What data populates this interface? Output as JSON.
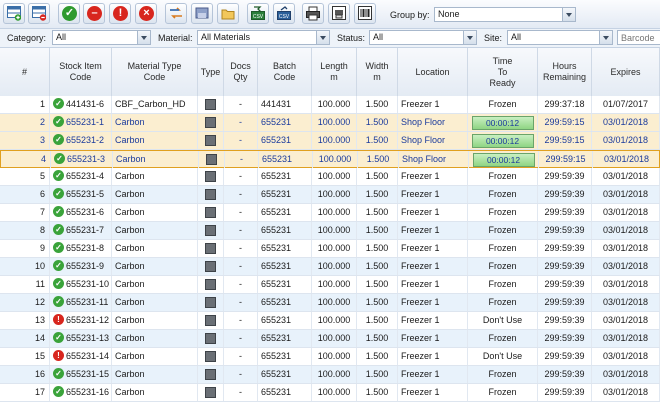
{
  "toolbar": {
    "group_by_label": "Group by:",
    "group_by_value": "None",
    "buttons": [
      {
        "name": "add-grid-icon"
      },
      {
        "name": "remove-grid-icon"
      },
      {
        "name": "approve-icon"
      },
      {
        "name": "stop-icon"
      },
      {
        "name": "alert-icon"
      },
      {
        "name": "cancel-icon"
      },
      {
        "name": "transfer-icon"
      },
      {
        "name": "location-icon"
      },
      {
        "name": "folder-icon"
      },
      {
        "name": "csv-import-icon",
        "label": "CSV"
      },
      {
        "name": "csv-export-icon",
        "label": "CSV"
      },
      {
        "name": "print-icon"
      },
      {
        "name": "print-preview-icon"
      },
      {
        "name": "barcode-icon"
      }
    ],
    "colors": {
      "green": "#2f9a2f",
      "red": "#d8261e"
    }
  },
  "filters": {
    "category_label": "Category:",
    "category_value": "All",
    "material_label": "Material:",
    "material_value": "All Materials",
    "status_label": "Status:",
    "status_value": "All",
    "site_label": "Site:",
    "site_value": "All",
    "barcode_placeholder": "Barcode"
  },
  "columns": {
    "num": "#",
    "stock": "Stock Item\nCode",
    "material": "Material Type\nCode",
    "type": "Type",
    "docs": "Docs\nQty",
    "batch": "Batch\nCode",
    "length": "Length\nm",
    "width": "Width\nm",
    "location": "Location",
    "time": "Time\nTo\nReady",
    "hours": "Hours\nRemaining",
    "expires": "Expires"
  },
  "rows": [
    {
      "num": "1",
      "status": "ok",
      "stock": "441431-6",
      "material": "CBF_Carbon_HD",
      "docs": "-",
      "batch": "441431",
      "length": "100.000",
      "width": "1.500",
      "location": "Freezer 1",
      "ready": "Frozen",
      "ready_bar": false,
      "hours": "299:37:18",
      "expires": "01/07/2017",
      "style": "odd"
    },
    {
      "num": "2",
      "status": "ok",
      "stock": "655231-1",
      "material": "Carbon",
      "docs": "-",
      "batch": "655231",
      "length": "100.000",
      "width": "1.500",
      "location": "Shop Floor",
      "ready": "00:00:12",
      "ready_bar": true,
      "hours": "299:59:15",
      "expires": "03/01/2018",
      "style": "hl"
    },
    {
      "num": "3",
      "status": "ok",
      "stock": "655231-2",
      "material": "Carbon",
      "docs": "-",
      "batch": "655231",
      "length": "100.000",
      "width": "1.500",
      "location": "Shop Floor",
      "ready": "00:00:12",
      "ready_bar": true,
      "hours": "299:59:15",
      "expires": "03/01/2018",
      "style": "hl"
    },
    {
      "num": "4",
      "status": "ok",
      "stock": "655231-3",
      "material": "Carbon",
      "docs": "-",
      "batch": "655231",
      "length": "100.000",
      "width": "1.500",
      "location": "Shop Floor",
      "ready": "00:00:12",
      "ready_bar": true,
      "hours": "299:59:15",
      "expires": "03/01/2018",
      "style": "cur"
    },
    {
      "num": "5",
      "status": "ok",
      "stock": "655231-4",
      "material": "Carbon",
      "docs": "-",
      "batch": "655231",
      "length": "100.000",
      "width": "1.500",
      "location": "Freezer 1",
      "ready": "Frozen",
      "ready_bar": false,
      "hours": "299:59:39",
      "expires": "03/01/2018",
      "style": "odd"
    },
    {
      "num": "6",
      "status": "ok",
      "stock": "655231-5",
      "material": "Carbon",
      "docs": "-",
      "batch": "655231",
      "length": "100.000",
      "width": "1.500",
      "location": "Freezer 1",
      "ready": "Frozen",
      "ready_bar": false,
      "hours": "299:59:39",
      "expires": "03/01/2018",
      "style": "even"
    },
    {
      "num": "7",
      "status": "ok",
      "stock": "655231-6",
      "material": "Carbon",
      "docs": "-",
      "batch": "655231",
      "length": "100.000",
      "width": "1.500",
      "location": "Freezer 1",
      "ready": "Frozen",
      "ready_bar": false,
      "hours": "299:59:39",
      "expires": "03/01/2018",
      "style": "odd"
    },
    {
      "num": "8",
      "status": "ok",
      "stock": "655231-7",
      "material": "Carbon",
      "docs": "-",
      "batch": "655231",
      "length": "100.000",
      "width": "1.500",
      "location": "Freezer 1",
      "ready": "Frozen",
      "ready_bar": false,
      "hours": "299:59:39",
      "expires": "03/01/2018",
      "style": "even"
    },
    {
      "num": "9",
      "status": "ok",
      "stock": "655231-8",
      "material": "Carbon",
      "docs": "-",
      "batch": "655231",
      "length": "100.000",
      "width": "1.500",
      "location": "Freezer 1",
      "ready": "Frozen",
      "ready_bar": false,
      "hours": "299:59:39",
      "expires": "03/01/2018",
      "style": "odd"
    },
    {
      "num": "10",
      "status": "ok",
      "stock": "655231-9",
      "material": "Carbon",
      "docs": "-",
      "batch": "655231",
      "length": "100.000",
      "width": "1.500",
      "location": "Freezer 1",
      "ready": "Frozen",
      "ready_bar": false,
      "hours": "299:59:39",
      "expires": "03/01/2018",
      "style": "even"
    },
    {
      "num": "11",
      "status": "ok",
      "stock": "655231-10",
      "material": "Carbon",
      "docs": "-",
      "batch": "655231",
      "length": "100.000",
      "width": "1.500",
      "location": "Freezer 1",
      "ready": "Frozen",
      "ready_bar": false,
      "hours": "299:59:39",
      "expires": "03/01/2018",
      "style": "odd"
    },
    {
      "num": "12",
      "status": "ok",
      "stock": "655231-11",
      "material": "Carbon",
      "docs": "-",
      "batch": "655231",
      "length": "100.000",
      "width": "1.500",
      "location": "Freezer 1",
      "ready": "Frozen",
      "ready_bar": false,
      "hours": "299:59:39",
      "expires": "03/01/2018",
      "style": "even"
    },
    {
      "num": "13",
      "status": "bad",
      "stock": "655231-12",
      "material": "Carbon",
      "docs": "-",
      "batch": "655231",
      "length": "100.000",
      "width": "1.500",
      "location": "Freezer 1",
      "ready": "Don't Use",
      "ready_bar": false,
      "hours": "299:59:39",
      "expires": "03/01/2018",
      "style": "odd"
    },
    {
      "num": "14",
      "status": "ok",
      "stock": "655231-13",
      "material": "Carbon",
      "docs": "-",
      "batch": "655231",
      "length": "100.000",
      "width": "1.500",
      "location": "Freezer 1",
      "ready": "Frozen",
      "ready_bar": false,
      "hours": "299:59:39",
      "expires": "03/01/2018",
      "style": "even"
    },
    {
      "num": "15",
      "status": "bad",
      "stock": "655231-14",
      "material": "Carbon",
      "docs": "-",
      "batch": "655231",
      "length": "100.000",
      "width": "1.500",
      "location": "Freezer 1",
      "ready": "Don't Use",
      "ready_bar": false,
      "hours": "299:59:39",
      "expires": "03/01/2018",
      "style": "odd"
    },
    {
      "num": "16",
      "status": "ok",
      "stock": "655231-15",
      "material": "Carbon",
      "docs": "-",
      "batch": "655231",
      "length": "100.000",
      "width": "1.500",
      "location": "Freezer 1",
      "ready": "Frozen",
      "ready_bar": false,
      "hours": "299:59:39",
      "expires": "03/01/2018",
      "style": "even"
    },
    {
      "num": "17",
      "status": "ok",
      "stock": "655231-16",
      "material": "Carbon",
      "docs": "-",
      "batch": "655231",
      "length": "100.000",
      "width": "1.500",
      "location": "Freezer 1",
      "ready": "Frozen",
      "ready_bar": false,
      "hours": "299:59:39",
      "expires": "03/01/2018",
      "style": "odd"
    }
  ]
}
